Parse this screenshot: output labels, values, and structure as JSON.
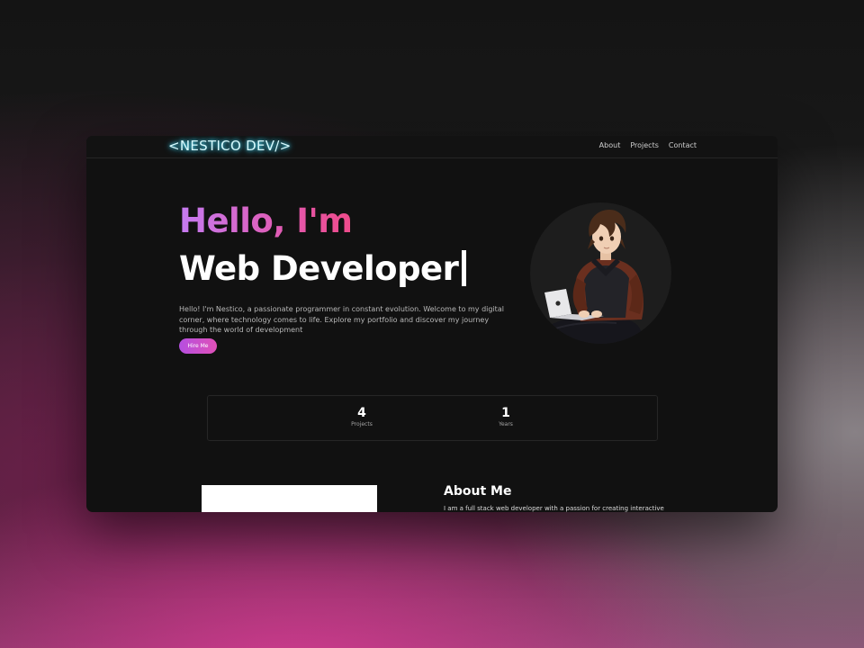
{
  "brand": {
    "logo": "<NESTICO DEV/>",
    "logo_color": "#d8fbff",
    "glow_color": "#2ac7ef"
  },
  "nav": {
    "items": [
      "About",
      "Projects",
      "Contact"
    ]
  },
  "hero": {
    "greeting": "Hello, I'm",
    "role": "Web Developer",
    "description": "Hello! I'm Nestico, a passionate programmer in constant evolution. Welcome to my digital corner, where technology comes to life. Explore my portfolio and discover my journey through the world of development",
    "cta": "Hire Me",
    "avatar_icon": "developer-laptop-illustration"
  },
  "stats": [
    {
      "value": "4",
      "label": "Projects"
    },
    {
      "value": "1",
      "label": "Years"
    }
  ],
  "about": {
    "title": "About Me",
    "text": "I am a full stack web developer with a passion for creating interactive"
  },
  "colors": {
    "accent_start": "#c57bf2",
    "accent_end": "#ee4b8a",
    "window_bg": "#111111"
  }
}
